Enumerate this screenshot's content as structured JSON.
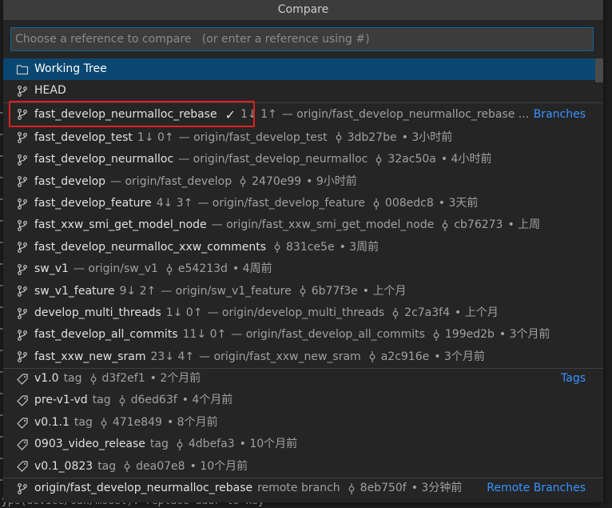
{
  "title": "Compare",
  "search": {
    "placeholder": "Choose a reference to compare   (or enter a reference using #)",
    "value": ""
  },
  "working_tree": {
    "label": "Working Tree"
  },
  "head": {
    "label": "HEAD"
  },
  "sections": {
    "branches": "Branches",
    "tags": "Tags",
    "remote": "Remote Branches"
  },
  "branches": [
    {
      "name": "fast_develop_neurmalloc_rebase",
      "current": "✓",
      "segs": [
        "1↓ 1↑",
        "— origin/fast_develop_neurmalloc_rebase ..."
      ],
      "sha": "",
      "time": ""
    },
    {
      "name": "fast_develop_test",
      "segs": [
        "1↓ 0↑",
        "— origin/fast_develop_test"
      ],
      "sha": "3db27be",
      "time": "3小时前"
    },
    {
      "name": "fast_develop_neurmalloc",
      "segs": [
        "— origin/fast_develop_neurmalloc"
      ],
      "sha": "32ac50a",
      "time": "4小时前"
    },
    {
      "name": "fast_develop",
      "segs": [
        "— origin/fast_develop"
      ],
      "sha": "2470e99",
      "time": "9小时前"
    },
    {
      "name": "fast_develop_feature",
      "segs": [
        "4↓ 3↑",
        "— origin/fast_develop_feature"
      ],
      "sha": "008edc8",
      "time": "3天前"
    },
    {
      "name": "fast_xxw_smi_get_model_node",
      "segs": [
        "— origin/fast_xxw_smi_get_model_node"
      ],
      "sha": "cb76273",
      "time": "上周"
    },
    {
      "name": "fast_develop_neurmalloc_xxw_comments",
      "segs": [],
      "sha": "831ce5e",
      "time": "3周前"
    },
    {
      "name": "sw_v1",
      "segs": [
        "— origin/sw_v1"
      ],
      "sha": "e54213d",
      "time": "4周前"
    },
    {
      "name": "sw_v1_feature",
      "segs": [
        "9↓ 2↑",
        "— origin/sw_v1_feature"
      ],
      "sha": "6b77f3e",
      "time": "上个月"
    },
    {
      "name": "develop_multi_threads",
      "segs": [
        "1↓ 0↑",
        "— origin/develop_multi_threads"
      ],
      "sha": "2c7a3f4",
      "time": "上个月"
    },
    {
      "name": "fast_develop_all_commits",
      "segs": [
        "11↓ 0↑",
        "— origin/fast_develop_all_commits"
      ],
      "sha": "199ed2b",
      "time": "3个月前"
    },
    {
      "name": "fast_xxw_new_sram",
      "segs": [
        "23↓ 4↑",
        "— origin/fast_xxw_new_sram"
      ],
      "sha": "a2c916e",
      "time": "3个月前"
    }
  ],
  "tags": [
    {
      "name": "v1.0",
      "kind": "tag",
      "sha": "d3f2ef1",
      "time": "2个月前"
    },
    {
      "name": "pre-v1-vd",
      "kind": "tag",
      "sha": "d6ed63f",
      "time": "4个月前"
    },
    {
      "name": "v0.1.1",
      "kind": "tag",
      "sha": "471e849",
      "time": "8个月前"
    },
    {
      "name": "0903_video_release",
      "kind": "tag",
      "sha": "4dbefa3",
      "time": "10个月前"
    },
    {
      "name": "v0.1_0823",
      "kind": "tag",
      "sha": "dea07e8",
      "time": "10个月前"
    }
  ],
  "remote": [
    {
      "name": "origin/fast_develop_neurmalloc_rebase",
      "kind": "remote branch",
      "sha": "8eb750f",
      "time": "3分钟前"
    }
  ],
  "background": {
    "bottom_text": "ype(device/oak/model): replace addr to key"
  },
  "colors": {
    "accent": "#3794ff",
    "selected": "#094771",
    "highlight": "#e02020"
  }
}
